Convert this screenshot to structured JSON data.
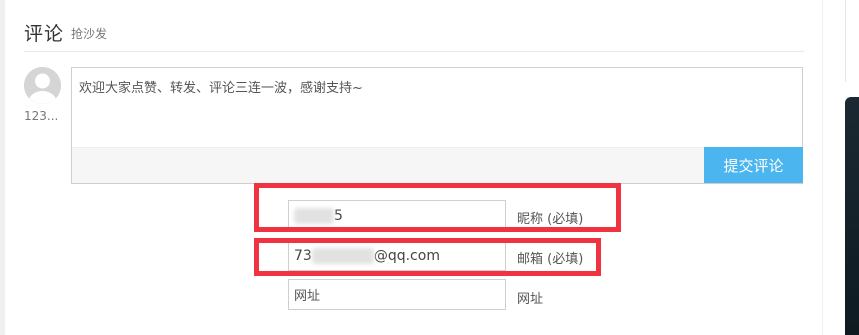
{
  "comments": {
    "title": "评论",
    "subtitle": "抢沙发",
    "user": {
      "name": "123..."
    },
    "textarea_value": "欢迎大家点赞、转发、评论三连一波，感谢支持~",
    "submit_label": "提交评论"
  },
  "form": {
    "nickname": {
      "value_suffix": "5",
      "label": "昵称 (必填)"
    },
    "email": {
      "value_prefix": "73",
      "value_suffix": "@qq.com",
      "label": "邮箱 (必填)"
    },
    "url": {
      "placeholder": "网址",
      "label": "网址"
    }
  },
  "colors": {
    "accent": "#4ab5ee",
    "highlight": "#ef3340"
  },
  "icons": {
    "avatar": "default-user-avatar-icon"
  }
}
